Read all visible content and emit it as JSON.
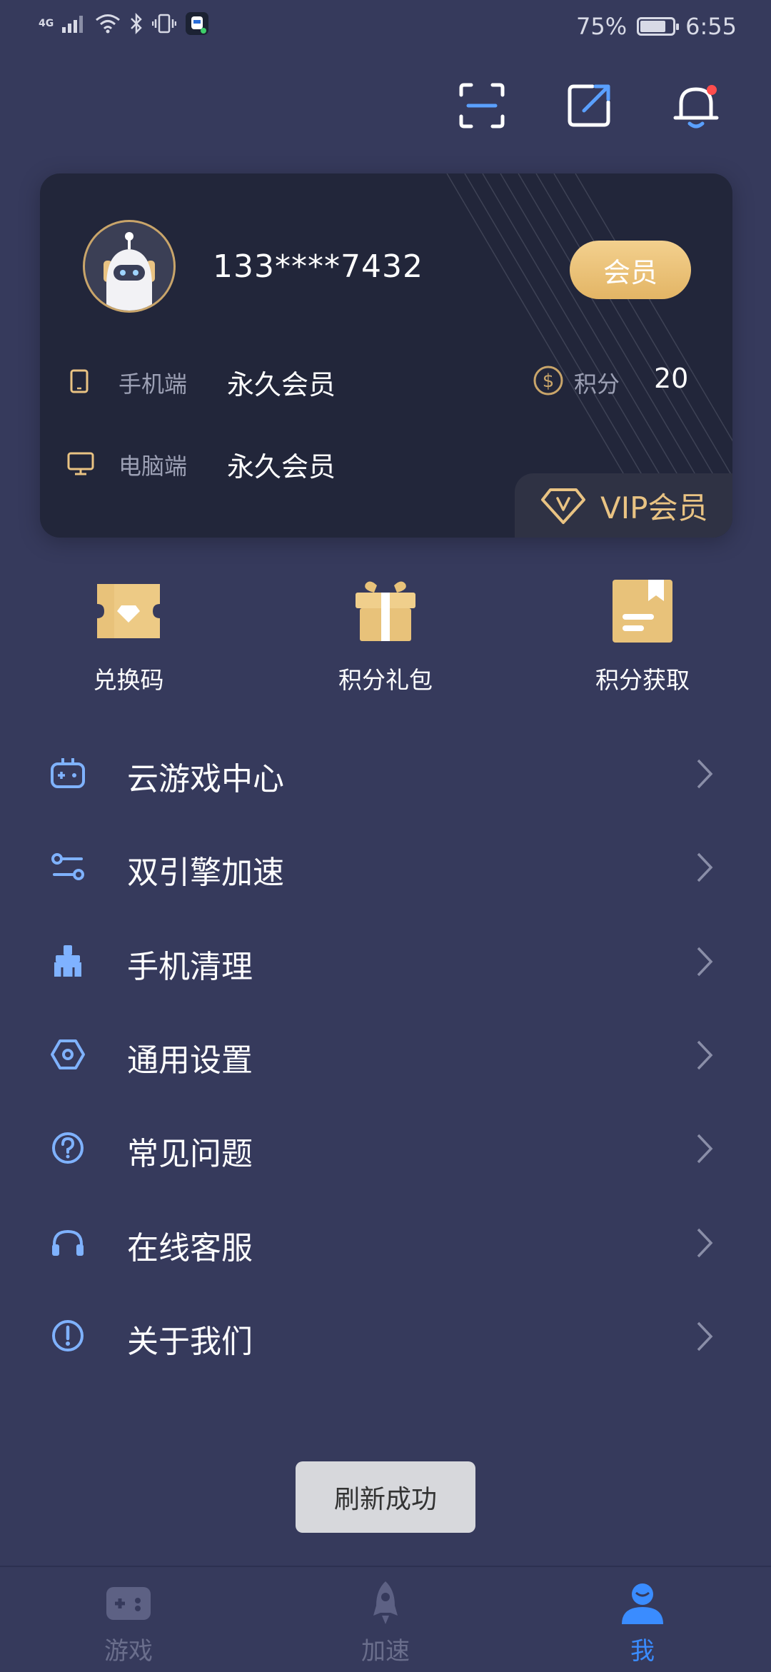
{
  "status_bar": {
    "network": "4G",
    "battery": "75%",
    "battery_level": 0.75,
    "time": "6:55"
  },
  "header": {
    "icons": [
      "scan-icon",
      "share-icon",
      "bell-icon"
    ]
  },
  "card": {
    "phone": "133****7432",
    "member_button": "会员",
    "mobile_label": "手机端",
    "mobile_value": "永久会员",
    "pc_label": "电脑端",
    "pc_value": "永久会员",
    "points_label": "积分",
    "points_value": "20",
    "vip_label": "VIP会员",
    "colors": {
      "gold": "#e9c383",
      "card_bg": "#22263a"
    }
  },
  "quick_actions": [
    {
      "label": "兑换码",
      "icon": "ticket-icon"
    },
    {
      "label": "积分礼包",
      "icon": "gift-icon"
    },
    {
      "label": "积分获取",
      "icon": "task-icon"
    }
  ],
  "menu": [
    {
      "label": "云游戏中心",
      "icon": "gamepad-icon"
    },
    {
      "label": "双引擎加速",
      "icon": "engine-icon"
    },
    {
      "label": "手机清理",
      "icon": "broom-icon"
    },
    {
      "label": "通用设置",
      "icon": "settings-icon"
    },
    {
      "label": "常见问题",
      "icon": "question-icon"
    },
    {
      "label": "在线客服",
      "icon": "headset-icon"
    },
    {
      "label": "关于我们",
      "icon": "info-icon"
    }
  ],
  "toast": "刷新成功",
  "bottom_nav": [
    {
      "label": "游戏",
      "icon": "gamepad-icon",
      "active": false
    },
    {
      "label": "加速",
      "icon": "rocket-icon",
      "active": false
    },
    {
      "label": "我",
      "icon": "user-icon",
      "active": true
    }
  ],
  "colors": {
    "background": "#363a5c",
    "accent_blue": "#3a8cff",
    "icon_blue": "#7fb2ff"
  }
}
